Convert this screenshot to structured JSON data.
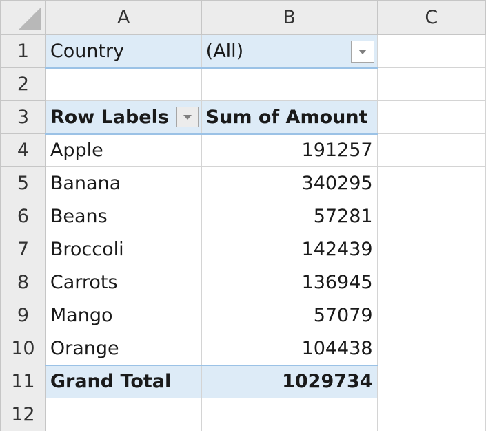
{
  "columns": [
    "A",
    "B",
    "C"
  ],
  "rows": [
    "1",
    "2",
    "3",
    "4",
    "5",
    "6",
    "7",
    "8",
    "9",
    "10",
    "11",
    "12"
  ],
  "filter": {
    "label": "Country",
    "value": "(All)"
  },
  "pivot": {
    "row_labels_header": "Row Labels",
    "value_header": "Sum of Amount",
    "items": [
      {
        "label": "Apple",
        "value": "191257"
      },
      {
        "label": "Banana",
        "value": "340295"
      },
      {
        "label": "Beans",
        "value": "57281"
      },
      {
        "label": "Broccoli",
        "value": "142439"
      },
      {
        "label": "Carrots",
        "value": "136945"
      },
      {
        "label": "Mango",
        "value": "57079"
      },
      {
        "label": "Orange",
        "value": "104438"
      }
    ],
    "grand_total_label": "Grand Total",
    "grand_total_value": "1029734"
  }
}
